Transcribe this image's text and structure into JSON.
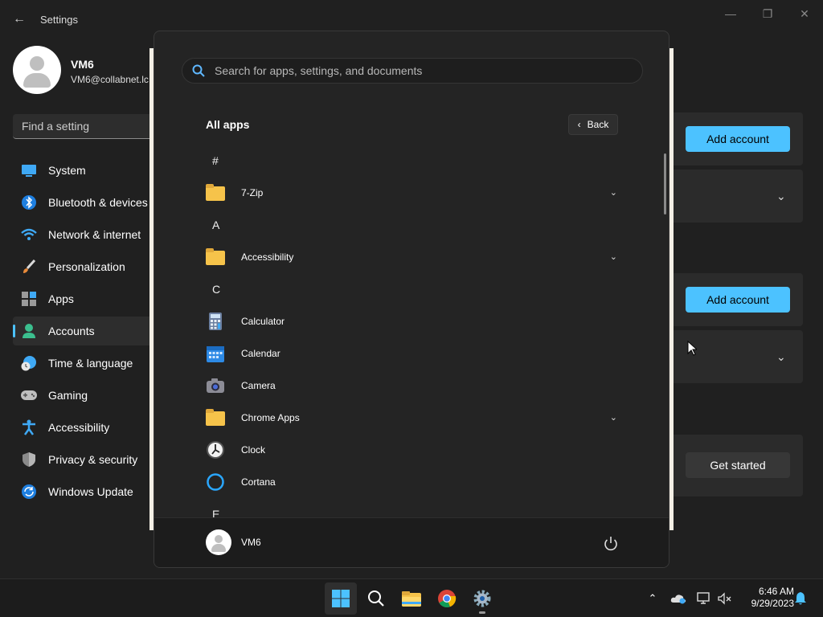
{
  "settings": {
    "title": "Settings",
    "profile": {
      "name": "VM6",
      "email": "VM6@collabnet.lc"
    },
    "search_placeholder": "Find a setting",
    "nav": [
      {
        "label": "System",
        "icon": "system-icon"
      },
      {
        "label": "Bluetooth & devices",
        "icon": "bluetooth-icon"
      },
      {
        "label": "Network & internet",
        "icon": "wifi-icon"
      },
      {
        "label": "Personalization",
        "icon": "brush-icon"
      },
      {
        "label": "Apps",
        "icon": "apps-icon"
      },
      {
        "label": "Accounts",
        "icon": "accounts-icon",
        "active": true
      },
      {
        "label": "Time & language",
        "icon": "globe-clock-icon"
      },
      {
        "label": "Gaming",
        "icon": "gamepad-icon"
      },
      {
        "label": "Accessibility",
        "icon": "accessibility-icon"
      },
      {
        "label": "Privacy & security",
        "icon": "shield-icon"
      },
      {
        "label": "Windows Update",
        "icon": "update-icon"
      }
    ],
    "right": {
      "add_account_1": "Add account",
      "add_account_2": "Add account",
      "get_started": "Get started"
    }
  },
  "start_menu": {
    "search_placeholder": "Search for apps, settings, and documents",
    "all_apps_label": "All apps",
    "back_label": "Back",
    "sections": [
      {
        "letter": "#",
        "apps": [
          {
            "name": "7-Zip",
            "icon": "folder-icon",
            "expandable": true
          }
        ]
      },
      {
        "letter": "A",
        "apps": [
          {
            "name": "Accessibility",
            "icon": "folder-icon",
            "expandable": true
          }
        ]
      },
      {
        "letter": "C",
        "apps": [
          {
            "name": "Calculator",
            "icon": "calculator-icon"
          },
          {
            "name": "Calendar",
            "icon": "calendar-icon"
          },
          {
            "name": "Camera",
            "icon": "camera-icon"
          },
          {
            "name": "Chrome Apps",
            "icon": "folder-icon",
            "expandable": true
          },
          {
            "name": "Clock",
            "icon": "clock-icon"
          },
          {
            "name": "Cortana",
            "icon": "cortana-icon"
          }
        ]
      },
      {
        "letter": "E",
        "apps": []
      }
    ],
    "user": "VM6"
  },
  "taskbar": {
    "time": "6:46 AM",
    "date": "9/29/2023"
  },
  "colors": {
    "accent": "#4cc2ff",
    "background": "#202020",
    "folder": "#f6c34a"
  }
}
